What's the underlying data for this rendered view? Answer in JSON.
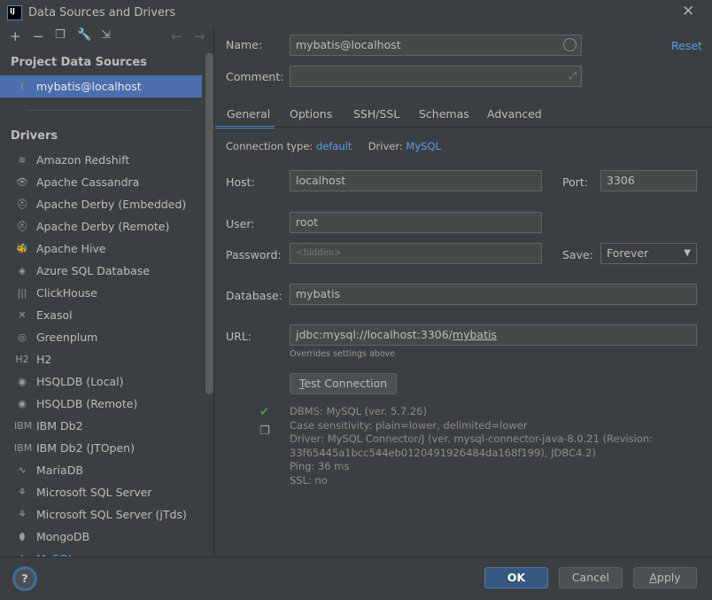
{
  "window": {
    "title": "Data Sources and Drivers",
    "logo": "IJ"
  },
  "toolbar": {
    "add": "+",
    "remove": "−",
    "copy": "copy-icon",
    "settings": "wrench-icon",
    "import": "import-icon",
    "back": "←",
    "forward": "→"
  },
  "left": {
    "project_header": "Project Data Sources",
    "project_items": [
      {
        "label": "mybatis@localhost",
        "selected": true
      }
    ],
    "drivers_header": "Drivers",
    "drivers": [
      "Amazon Redshift",
      "Apache Cassandra",
      "Apache Derby (Embedded)",
      "Apache Derby (Remote)",
      "Apache Hive",
      "Azure SQL Database",
      "ClickHouse",
      "Exasol",
      "Greenplum",
      "H2",
      "HSQLDB (Local)",
      "HSQLDB (Remote)",
      "IBM Db2",
      "IBM Db2 (JTOpen)",
      "MariaDB",
      "Microsoft SQL Server",
      "Microsoft SQL Server (jTds)",
      "MongoDB",
      "MySQL"
    ]
  },
  "form": {
    "name_label": "Name:",
    "name_value": "mybatis@localhost",
    "reset": "Reset",
    "comment_label": "Comment:",
    "comment_value": "",
    "tabs": [
      "General",
      "Options",
      "SSH/SSL",
      "Schemas",
      "Advanced"
    ],
    "active_tab": "General",
    "conn_type_label": "Connection type:",
    "conn_type": "default",
    "driver_label": "Driver:",
    "driver": "MySQL",
    "host_label": "Host:",
    "host": "localhost",
    "port_label": "Port:",
    "port": "3306",
    "user_label": "User:",
    "user": "root",
    "password_label": "Password:",
    "password_placeholder": "<hidden>",
    "save_label": "Save:",
    "save_value": "Forever",
    "database_label": "Database:",
    "database": "mybatis",
    "url_label": "URL:",
    "url_prefix": "jdbc:mysql://localhost:3306/",
    "url_db": "mybatis",
    "url_hint": "Overrides settings above",
    "test_connection_t": "T",
    "test_connection_rest": "est Connection",
    "info": [
      "DBMS: MySQL (ver. 5.7.26)",
      "Case sensitivity: plain=lower, delimited=lower",
      "Driver: MySQL Connector/J (ver. mysql-connector-java-8.0.21 (Revision:",
      "33f65445a1bcc544eb0120491926484da168f199), JDBC4.2)",
      "Ping: 36 ms",
      "SSL: no"
    ]
  },
  "footer": {
    "help": "?",
    "ok": "OK",
    "cancel": "Cancel",
    "apply_a": "A",
    "apply_rest": "pply"
  },
  "colors": {
    "accent": "#589df6",
    "selection": "#4b6eaf",
    "success": "#499c54",
    "ok_button": "#365880"
  }
}
